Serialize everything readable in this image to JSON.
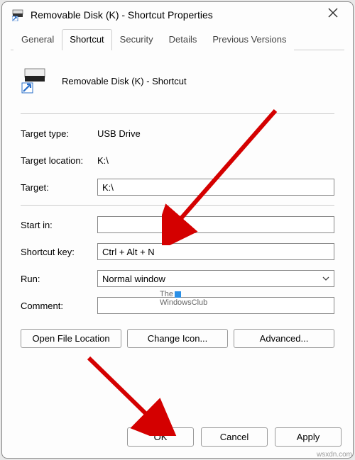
{
  "title": "Removable Disk (K) - Shortcut Properties",
  "tabs": {
    "general": "General",
    "shortcut": "Shortcut",
    "security": "Security",
    "details": "Details",
    "previous": "Previous Versions"
  },
  "header": {
    "name": "Removable Disk (K) - Shortcut"
  },
  "fields": {
    "target_type_label": "Target type:",
    "target_type_value": "USB Drive",
    "target_location_label": "Target location:",
    "target_location_value": "K:\\",
    "target_label": "Target:",
    "target_value": "K:\\",
    "start_in_label": "Start in:",
    "start_in_value": "",
    "shortcut_key_label": "Shortcut key:",
    "shortcut_key_value": "Ctrl + Alt + N",
    "run_label": "Run:",
    "run_value": "Normal window",
    "comment_label": "Comment:",
    "comment_value": ""
  },
  "buttons": {
    "open_location": "Open File Location",
    "change_icon": "Change Icon...",
    "advanced": "Advanced...",
    "ok": "OK",
    "cancel": "Cancel",
    "apply": "Apply"
  },
  "watermark": {
    "line1": "The",
    "line2": "WindowsClub"
  },
  "footer_watermark": "wsxdn.com"
}
